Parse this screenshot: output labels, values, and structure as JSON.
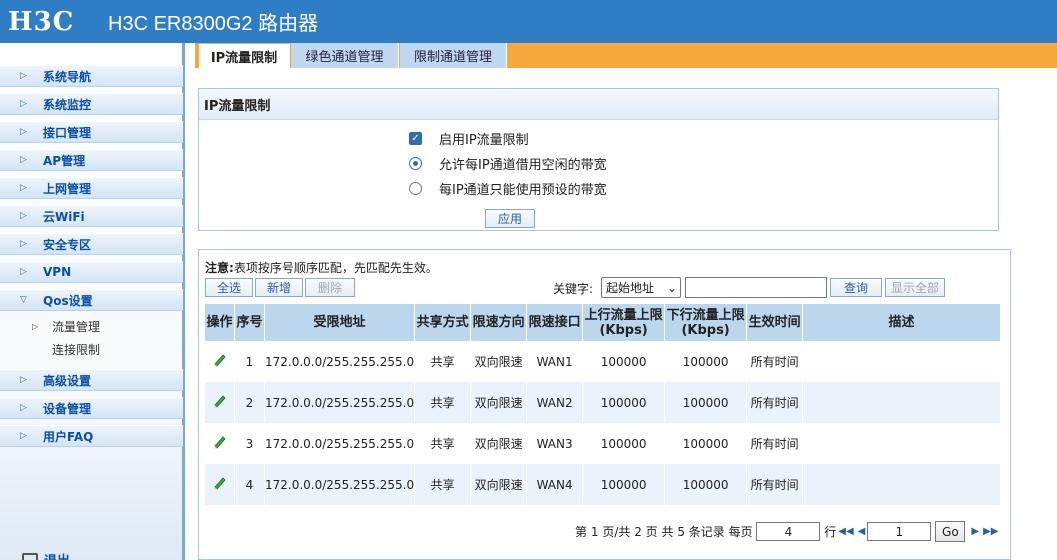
{
  "header": {
    "logo": "H3C",
    "title": "H3C ER8300G2 路由器"
  },
  "sidebar": {
    "items": [
      {
        "label": "系统导航",
        "icon": "arrow-right-icon"
      },
      {
        "label": "系统监控",
        "icon": "arrow-right-icon"
      },
      {
        "label": "接口管理",
        "icon": "arrow-right-icon"
      },
      {
        "label": "AP管理",
        "icon": "arrow-right-icon"
      },
      {
        "label": "上网管理",
        "icon": "arrow-right-icon"
      },
      {
        "label": "云WiFi",
        "icon": "arrow-right-icon"
      },
      {
        "label": "安全专区",
        "icon": "arrow-right-icon"
      },
      {
        "label": "VPN",
        "icon": "arrow-right-icon"
      },
      {
        "label": "Qos设置",
        "icon": "arrow-down-icon",
        "expanded": true
      },
      {
        "label": "高级设置",
        "icon": "arrow-right-icon"
      },
      {
        "label": "设备管理",
        "icon": "arrow-right-icon"
      },
      {
        "label": "用户FAQ",
        "icon": "arrow-right-icon"
      }
    ],
    "subitems": [
      {
        "label": "流量管理",
        "active": true
      },
      {
        "label": "连接限制",
        "active": false
      }
    ],
    "logout": "退出"
  },
  "tabs": [
    {
      "label": "IP流量限制",
      "active": true
    },
    {
      "label": "绿色通道管理",
      "active": false
    },
    {
      "label": "限制通道管理",
      "active": false
    }
  ],
  "settings": {
    "title": "IP流量限制",
    "enable_label": "启用IP流量限制",
    "enable_checked": true,
    "option_borrow": "允许每IP通道借用空闲的带宽",
    "option_preset": "每IP通道只能使用预设的带宽",
    "selected_option": "borrow",
    "apply_label": "应用"
  },
  "list": {
    "note_label": "注意:",
    "note_text": "表项按序号顺序匹配，先匹配先生效。",
    "select_all": "全选",
    "add": "新增",
    "delete": "删除",
    "keyword_label": "关键字:",
    "keyword_selected": "起始地址",
    "keyword_value": "",
    "search": "查询",
    "show_all": "显示全部",
    "columns": [
      "操作",
      "序号",
      "受限地址",
      "共享方式",
      "限速方向",
      "限速接口",
      "上行流量上限\n(Kbps)",
      "下行流量上限\n(Kbps)",
      "生效时间",
      "描述"
    ],
    "rows": [
      {
        "index": "1",
        "address": "172.0.0.0/255.255.255.0",
        "share": "共享",
        "direction": "双向限速",
        "iface": "WAN1",
        "up": "100000",
        "down": "100000",
        "time": "所有时间",
        "desc": ""
      },
      {
        "index": "2",
        "address": "172.0.0.0/255.255.255.0",
        "share": "共享",
        "direction": "双向限速",
        "iface": "WAN2",
        "up": "100000",
        "down": "100000",
        "time": "所有时间",
        "desc": ""
      },
      {
        "index": "3",
        "address": "172.0.0.0/255.255.255.0",
        "share": "共享",
        "direction": "双向限速",
        "iface": "WAN3",
        "up": "100000",
        "down": "100000",
        "time": "所有时间",
        "desc": ""
      },
      {
        "index": "4",
        "address": "172.0.0.0/255.255.255.0",
        "share": "共享",
        "direction": "双向限速",
        "iface": "WAN4",
        "up": "100000",
        "down": "100000",
        "time": "所有时间",
        "desc": ""
      }
    ]
  },
  "pager": {
    "text1": "第",
    "current_page": "1",
    "text2": "页/共",
    "total_pages": "2",
    "text3": "页 共",
    "total_records": "5",
    "text4": "条记录 每页",
    "per_page": "4",
    "text5": "行",
    "goto_value": "1",
    "go_label": "Go"
  },
  "colors": {
    "header_bg": "#2f7ec5",
    "tab_bar": "#f6a93b",
    "table_header": "#bcd6ee",
    "link_blue": "#0b4ea2"
  }
}
